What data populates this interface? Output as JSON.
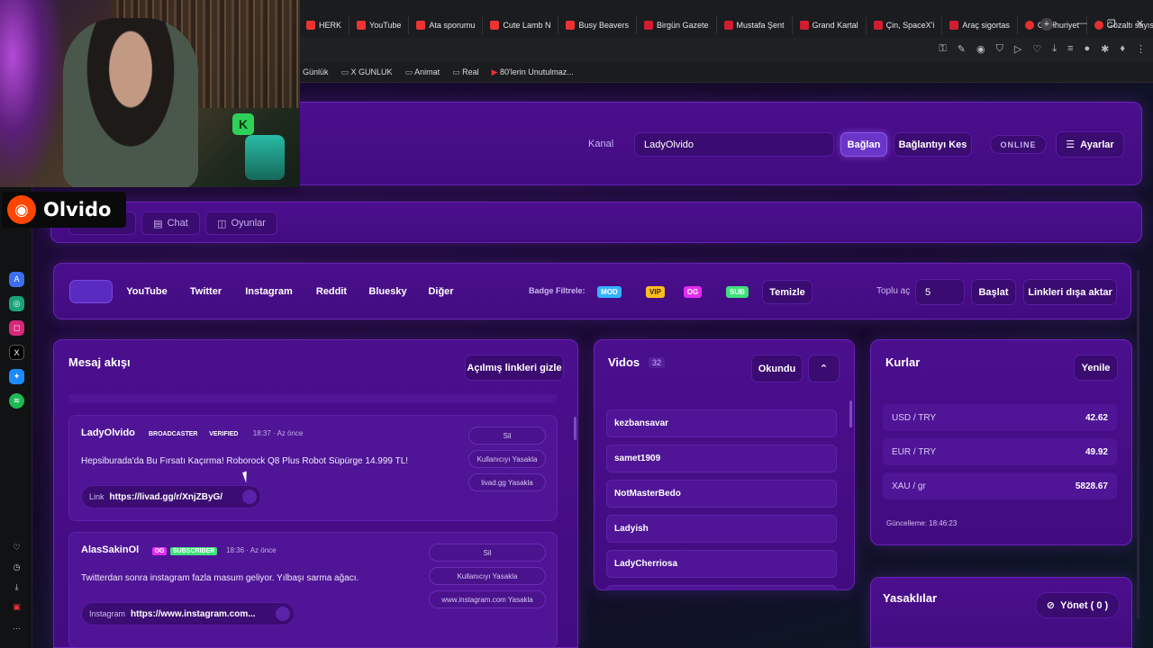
{
  "browser": {
    "tabs": [
      {
        "label": "HERK",
        "fav": "yt"
      },
      {
        "label": "YouTube",
        "fav": "yt"
      },
      {
        "label": "Ata sporumu",
        "fav": "yt"
      },
      {
        "label": "Cute Lamb N",
        "fav": "yt"
      },
      {
        "label": "Busy Beavers",
        "fav": "yt"
      },
      {
        "label": "Birgün Gazete",
        "fav": "b"
      },
      {
        "label": "Mustafa Şent",
        "fav": "b"
      },
      {
        "label": "Grand Kartal",
        "fav": "b"
      },
      {
        "label": "Çin, SpaceX'i",
        "fav": "b"
      },
      {
        "label": "Araç sigortas",
        "fav": "b"
      },
      {
        "label": "Cumhuriyet",
        "fav": "c"
      },
      {
        "label": "Gözaltı sayısı",
        "fav": "c"
      }
    ],
    "bookmarks": [
      {
        "label": "Günlük",
        "kind": "plain"
      },
      {
        "label": "X GUNLUK",
        "kind": "folder"
      },
      {
        "label": "Animat",
        "kind": "folder"
      },
      {
        "label": "Real",
        "kind": "folder"
      },
      {
        "label": "80'lerin Unutulmaz...",
        "kind": "yt"
      }
    ]
  },
  "overlay": {
    "streamer_name": "Olvido"
  },
  "header": {
    "channel_label": "Kanal",
    "channel_value": "LadyOlvido",
    "connect_label": "Bağlan",
    "disconnect_label": "Bağlantıyı Kes",
    "status_label": "ONLINE",
    "settings_label": "Ayarlar"
  },
  "nav": {
    "tabs": [
      {
        "label": ""
      },
      {
        "label": "Chat"
      },
      {
        "label": "Oyunlar"
      }
    ]
  },
  "filters": {
    "platforms": [
      "",
      "YouTube",
      "Twitter",
      "Instagram",
      "Reddit",
      "Bluesky",
      "Diğer"
    ],
    "badge_filter_label": "Badge Filtrele:",
    "badges": [
      {
        "label": "MOD",
        "color": "#33b3ff"
      },
      {
        "label": "VIP",
        "color": "#ffbe1f"
      },
      {
        "label": "OG",
        "color": "#e22cf0"
      },
      {
        "label": "SUB",
        "color": "#3ee07a"
      }
    ],
    "clear_label": "Temizle",
    "bulk_open_label": "Toplu aç",
    "bulk_open_value": "5",
    "start_label": "Başlat",
    "export_label": "Linkleri dışa aktar"
  },
  "feed": {
    "title": "Mesaj akışı",
    "hide_opened_label": "Açılmış linkleri gizle",
    "messages": [
      {
        "user": "LadyOlvido",
        "user_color": "#ffffff",
        "badges": [
          {
            "label": "BROADCASTER",
            "color": ""
          },
          {
            "label": "VERIFIED",
            "color": ""
          }
        ],
        "time": "18:37 · Az önce",
        "text": "Hepsiburada'da Bu Fırsatı Kaçırma! Roborock Q8 Plus Robot Süpürge 14.999 TL!",
        "link_kind": "Link",
        "link": "https://livad.gg/r/XnjZByG/",
        "actions": [
          "Sil",
          "Kullanıcıyı Yasakla",
          "livad.gg Yasakla"
        ]
      },
      {
        "user": "AlasSakinOl",
        "user_color": "#ffffff",
        "badges": [
          {
            "label": "OG",
            "color": "#e22cf0"
          },
          {
            "label": "SUBSCRIBER",
            "color": "#3ee07a"
          }
        ],
        "time": "18:36 · Az önce",
        "text": "Twitterdan sonra instagram fazla masum geliyor. Yılbaşı sarma ağacı.",
        "link_kind": "Instagram",
        "link": "https://www.instagram.com...",
        "actions": [
          "Sil",
          "Kullanıcıyı Yasakla",
          "www.instagram.com Yasakla"
        ]
      }
    ]
  },
  "videos": {
    "title": "Vidos",
    "count": "32",
    "read_label": "Okundu",
    "items": [
      "kezbansavar",
      "samet1909",
      "NotMasterBedo",
      "Ladyish",
      "LadyCherriosa"
    ]
  },
  "rates": {
    "title": "Kurlar",
    "refresh_label": "Yenile",
    "rows": [
      {
        "pair": "USD / TRY",
        "value": "42.62"
      },
      {
        "pair": "EUR / TRY",
        "value": "49.92"
      },
      {
        "pair": "XAU / gr",
        "value": "5828.67"
      }
    ],
    "updated": "Güncelleme: 18:46:23"
  },
  "bans": {
    "title": "Yasaklılar",
    "manage_label": "Yönet ( 0 )"
  },
  "colors": {
    "accent": "#6a22b8",
    "card": "#4b0f8e",
    "bg": "#150a2b"
  }
}
